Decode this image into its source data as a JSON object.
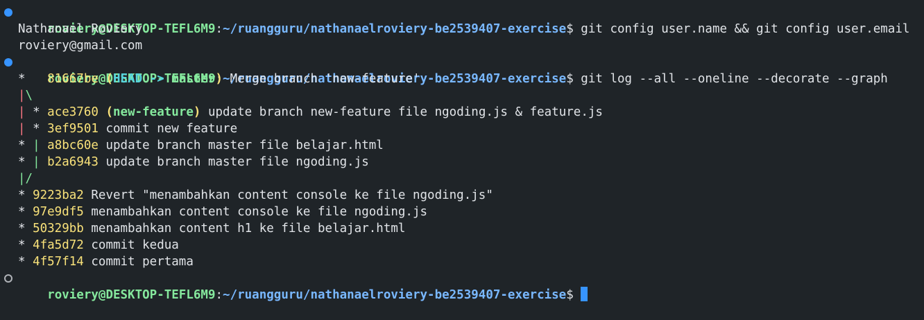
{
  "colors": {
    "background": "#1f2428",
    "prompt_user": "#85e89d",
    "prompt_path": "#79b8ff",
    "commit_hash": "#f9e27a",
    "ref_head": "#56d4dd",
    "ref_branch": "#85e89d",
    "graph_line_red": "#f97583",
    "graph_line_green": "#85e89d",
    "cursor": "#3794ff"
  },
  "prompt": {
    "user_host": "roviery@DESKTOP-TEFL6M9",
    "sep": ":",
    "path": "~/ruangguru/nathanaelroviery-be2539407-exercise",
    "symbol": "$"
  },
  "commands": {
    "first": " git config user.name && git config user.email",
    "second": " git log --all --oneline --decorate --graph"
  },
  "output": {
    "name": "Nathanael Roviery",
    "email": "roviery@gmail.com"
  },
  "log": {
    "l1": {
      "graph": "*   ",
      "hash": "81667be",
      "open": " (",
      "head": "HEAD -> ",
      "branch": "master",
      "close": ")",
      "msg": " Merge branch 'new-feature'"
    },
    "l2": {
      "g1": "|",
      "g2": "\\"
    },
    "l3": {
      "g1": "|",
      "mid": " * ",
      "hash": "ace3760",
      "open": " (",
      "branch": "new-feature",
      "close": ")",
      "msg": " update branch new-feature file ngoding.js & feature.js"
    },
    "l4": {
      "g1": "|",
      "mid": " * ",
      "hash": "3ef9501",
      "msg": " commit new feature"
    },
    "l5": {
      "g0": "* ",
      "g1": "|",
      "sp": " ",
      "hash": "a8bc60e",
      "msg": " update branch master file belajar.html"
    },
    "l6": {
      "g0": "* ",
      "g1": "|",
      "sp": " ",
      "hash": "b2a6943",
      "msg": " update branch master file ngoding.js"
    },
    "l7": {
      "g1": "|",
      "g2": "/"
    },
    "l8": {
      "graph": "* ",
      "hash": "9223ba2",
      "msg": " Revert \"menambahkan content console ke file ngoding.js\""
    },
    "l9": {
      "graph": "* ",
      "hash": "97e9df5",
      "msg": " menambahkan content console ke file ngoding.js"
    },
    "l10": {
      "graph": "* ",
      "hash": "50329bb",
      "msg": " menambahkan content h1 ke file belajar.html"
    },
    "l11": {
      "graph": "* ",
      "hash": "4fa5d72",
      "msg": " commit kedua"
    },
    "l12": {
      "graph": "* ",
      "hash": "4f57f14",
      "msg": " commit pertama"
    }
  }
}
